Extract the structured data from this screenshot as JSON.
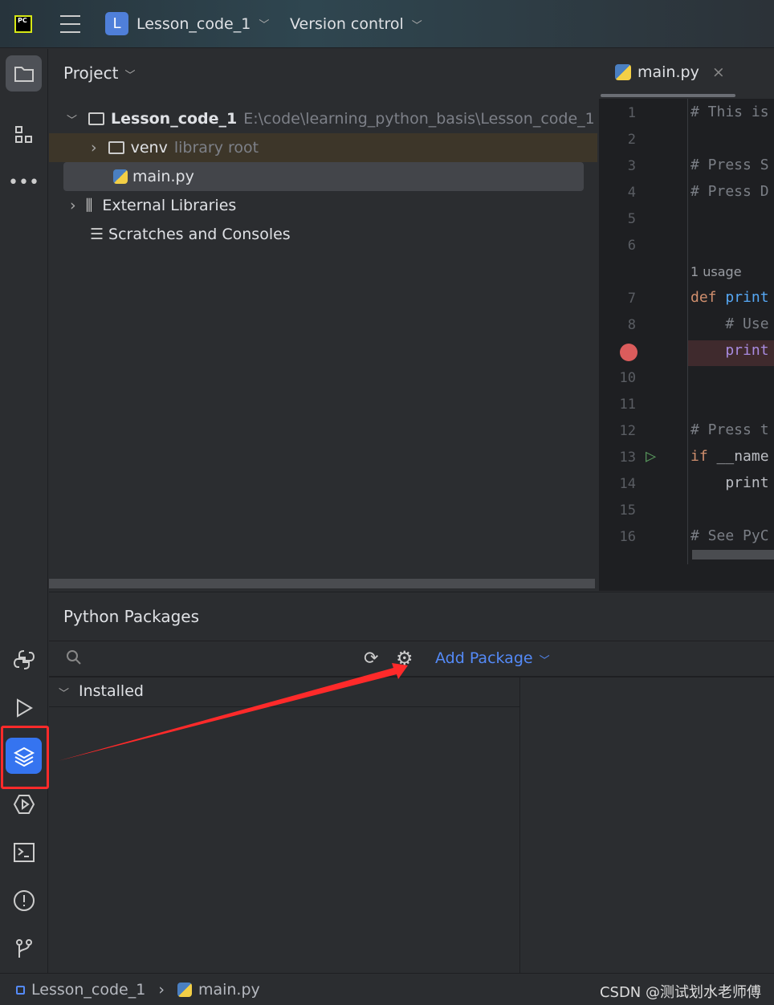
{
  "titlebar": {
    "logo": "PC",
    "menu_icon": "hamburger-icon",
    "project_badge": "L",
    "project_name": "Lesson_code_1",
    "vcs": "Version control"
  },
  "project_panel": {
    "title": "Project",
    "tree": [
      {
        "label": "Lesson_code_1",
        "hint": "E:\\code\\learning_python_basis\\Lesson_code_1"
      },
      {
        "label": "venv",
        "hint": "library root"
      },
      {
        "label": "main.py"
      },
      {
        "label": "External Libraries"
      },
      {
        "label": "Scratches and Consoles"
      }
    ]
  },
  "editor": {
    "tab": "main.py",
    "usage_hint": "1 usage",
    "lines": [
      {
        "n": "1",
        "text": "# This is",
        "kind": "comment"
      },
      {
        "n": "2",
        "text": ""
      },
      {
        "n": "3",
        "text": "# Press S",
        "kind": "comment"
      },
      {
        "n": "4",
        "text": "# Press D",
        "kind": "comment"
      },
      {
        "n": "5",
        "text": ""
      },
      {
        "n": "6",
        "text": ""
      },
      {
        "n": "7",
        "kw": "def ",
        "text": "print",
        "kind": "fn"
      },
      {
        "n": "8",
        "text": "    # Use",
        "kind": "comment"
      },
      {
        "n": "9",
        "text": "    print",
        "kind": "call",
        "breakpoint": true
      },
      {
        "n": "10",
        "text": ""
      },
      {
        "n": "11",
        "text": ""
      },
      {
        "n": "12",
        "text": "# Press t",
        "kind": "comment"
      },
      {
        "n": "13",
        "kw": "if ",
        "text": "__name",
        "kind": "plain",
        "run": true
      },
      {
        "n": "14",
        "text": "    print",
        "kind": "plain"
      },
      {
        "n": "15",
        "text": ""
      },
      {
        "n": "16",
        "text": "# See PyC",
        "kind": "comment"
      }
    ]
  },
  "packages": {
    "title": "Python Packages",
    "add_label": "Add Package",
    "installed_label": "Installed"
  },
  "statusbar": {
    "project": "Lesson_code_1",
    "file": "main.py",
    "watermark": "CSDN @测试划水老师傅"
  },
  "colors": {
    "accent": "#548af7",
    "annotation": "#ff2a2a",
    "breakpoint": "#db5c5c"
  }
}
